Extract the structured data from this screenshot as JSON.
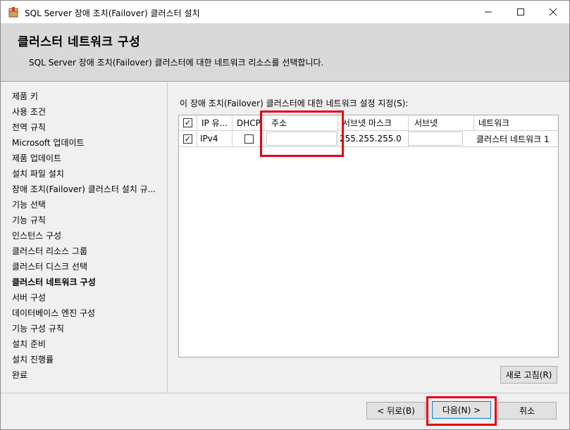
{
  "window": {
    "title": "SQL Server 장애 조치(Failover) 클러스터 설치",
    "app_icon": "sql-server-setup-box-icon",
    "controls": [
      "minimize-icon",
      "maximize-icon",
      "close-icon"
    ]
  },
  "header": {
    "title": "클러스터 네트워크 구성",
    "subtitle": "SQL Server 장애 조치(Failover) 클러스터에 대한 네트워크 리소스를 선택합니다."
  },
  "nav": {
    "items": [
      {
        "label": "제품 키"
      },
      {
        "label": "사용 조건"
      },
      {
        "label": "전역 규칙"
      },
      {
        "label": "Microsoft 업데이트"
      },
      {
        "label": "제품 업데이트"
      },
      {
        "label": "설치 파일 설치"
      },
      {
        "label": "장애 조치(Failover) 클러스터 설치 규..."
      },
      {
        "label": "기능 선택"
      },
      {
        "label": "기능 규칙"
      },
      {
        "label": "인스턴스 구성"
      },
      {
        "label": "클러스터 리소스 그룹"
      },
      {
        "label": "클러스터 디스크 선택"
      },
      {
        "label": "클러스터 네트워크 구성"
      },
      {
        "label": "서버 구성"
      },
      {
        "label": "데이터베이스 엔진 구성"
      },
      {
        "label": "기능 구성 규칙"
      },
      {
        "label": "설치 준비"
      },
      {
        "label": "설치 진행률"
      },
      {
        "label": "완료"
      }
    ],
    "active_index": 12
  },
  "main": {
    "table_caption": "이 장애 조치(Failover) 클러스터에 대한 네트워크 설정 지정(S):",
    "columns": [
      "IP 유...",
      "DHCP",
      "주소",
      "서브넷 마스크",
      "서브넷",
      "네트워크"
    ],
    "rows": [
      {
        "checked": true,
        "ip_type": "IPv4",
        "dhcp": false,
        "address": "",
        "subnet_mask": "255.255.255.0",
        "subnet": "",
        "network": "클러스터 네트워크 1"
      }
    ],
    "refresh_button": "새로 고침(R)"
  },
  "footer": {
    "back_button": "< 뒤로(B)",
    "next_button": "다음(N) >",
    "cancel_button": "취소"
  },
  "colors": {
    "highlight": "#e60012",
    "header_bg": "#d9d9d9",
    "window_bg": "#f0f0f0"
  }
}
